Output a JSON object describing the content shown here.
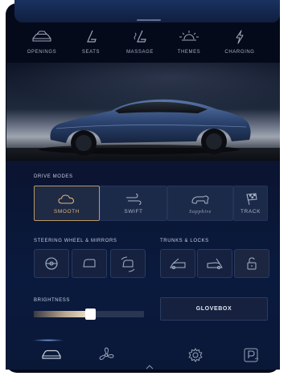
{
  "quick_actions": [
    {
      "label": "OPENINGS",
      "icon": "car-openings-icon"
    },
    {
      "label": "SEATS",
      "icon": "seat-icon"
    },
    {
      "label": "MASSAGE",
      "icon": "massage-seat-icon"
    },
    {
      "label": "THEMES",
      "icon": "sunrise-icon"
    },
    {
      "label": "CHARGING",
      "icon": "lightning-icon"
    }
  ],
  "drive_modes": {
    "title": "DRIVE MODES",
    "modes": [
      {
        "label": "SMOOTH",
        "icon": "cloud-icon",
        "active": true
      },
      {
        "label": "SWIFT",
        "icon": "wind-icon",
        "active": false
      },
      {
        "label": "Sapphire",
        "icon": "bear-icon",
        "active": false
      },
      {
        "label": "TRACK",
        "icon": "checkered-flag-icon",
        "active": false
      }
    ]
  },
  "steering": {
    "title": "STEERING WHEEL & MIRRORS",
    "icons": [
      "steering-wheel-icon",
      "mirror-icon",
      "mirror-adjust-icon"
    ]
  },
  "trunks": {
    "title": "TRUNKS & LOCKS",
    "icons": [
      "frunk-icon",
      "trunk-icon",
      "unlock-icon"
    ]
  },
  "brightness": {
    "title": "BRIGHTNESS",
    "value": 0.52
  },
  "glovebox": {
    "label": "GLOVEBOX"
  },
  "dock": [
    {
      "icon": "car-icon",
      "active": true
    },
    {
      "icon": "fan-icon",
      "active": false
    },
    {
      "icon": "gear-icon",
      "active": false
    },
    {
      "icon": "parking-icon",
      "active": false
    }
  ],
  "colors": {
    "background": "#050a1a",
    "panel": "#0a1838",
    "accent": "#d8b47e",
    "tile": "#15213f",
    "text": "#c8cfdd"
  }
}
